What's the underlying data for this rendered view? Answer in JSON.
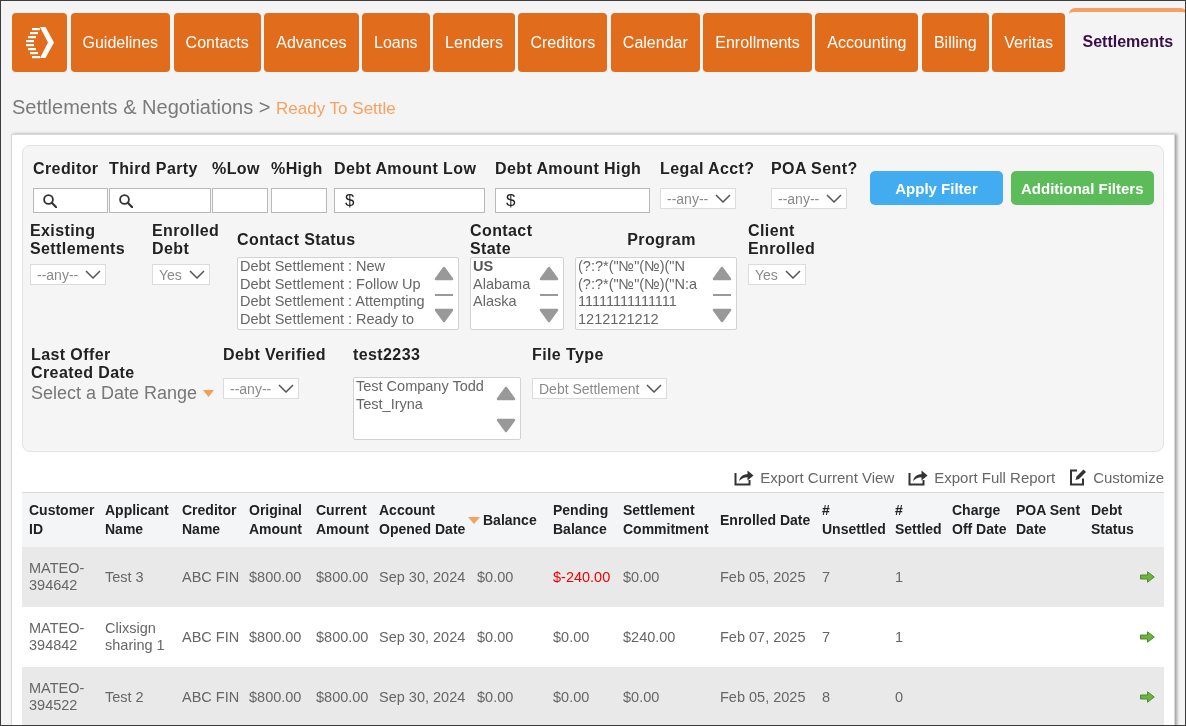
{
  "nav": {
    "tabs": [
      {
        "label": "Guidelines",
        "selected": false
      },
      {
        "label": "Contacts",
        "selected": false
      },
      {
        "label": "Advances",
        "selected": false
      },
      {
        "label": "Loans",
        "selected": false
      },
      {
        "label": "Lenders",
        "selected": false
      },
      {
        "label": "Creditors",
        "selected": false
      },
      {
        "label": "Calendar",
        "selected": false
      },
      {
        "label": "Enrollments",
        "selected": false
      },
      {
        "label": "Accounting",
        "selected": false
      },
      {
        "label": "Billing",
        "selected": false
      },
      {
        "label": "Veritas",
        "selected": false
      },
      {
        "label": "Settlements",
        "selected": true
      }
    ]
  },
  "breadcrumb": {
    "items": [
      {
        "label": "Settlements & Negotiations",
        "current": false
      },
      {
        "label": "Ready To Settle",
        "current": true
      }
    ],
    "separator": ">"
  },
  "filters": {
    "rows": [
      {
        "fields": [
          {
            "kind": "search",
            "label": "Creditor"
          },
          {
            "kind": "search",
            "label": "Third Party"
          },
          {
            "kind": "text",
            "label": "%Low"
          },
          {
            "kind": "text",
            "label": "%High"
          },
          {
            "kind": "money",
            "label": "Debt Amount Low",
            "prefix": "$"
          },
          {
            "kind": "money",
            "label": "Debt Amount High",
            "prefix": "$"
          },
          {
            "kind": "select",
            "label": "Legal Acct?",
            "value": "--any--"
          },
          {
            "kind": "select",
            "label": "POA Sent?",
            "value": "--any--"
          }
        ]
      },
      {
        "fields": [
          {
            "kind": "select",
            "label": "Existing Settlements",
            "value": "--any--"
          },
          {
            "kind": "select",
            "label": "Enrolled Debt",
            "value": "Yes"
          },
          {
            "kind": "listbox",
            "label": "Contact Status",
            "options": [
              {
                "label": "Debt Settlement : New",
                "kind": "option"
              },
              {
                "label": "Debt Settlement : Follow Up",
                "kind": "option"
              },
              {
                "label": "Debt Settlement : Attempting",
                "kind": "option"
              },
              {
                "label": "Debt Settlement : Ready to",
                "kind": "option"
              }
            ]
          },
          {
            "kind": "listbox",
            "label": "Contact State",
            "options": [
              {
                "label": "US",
                "kind": "group"
              },
              {
                "label": "Alabama",
                "kind": "option"
              },
              {
                "label": "Alaska",
                "kind": "option"
              }
            ]
          },
          {
            "kind": "listbox",
            "label": "Program",
            "options": [
              {
                "label": "(?:?*(\"№\"(№)(\"N",
                "kind": "option"
              },
              {
                "label": "(?:?*(\"№\"(№)(\"N:a",
                "kind": "option"
              },
              {
                "label": "11111111111111",
                "kind": "option"
              },
              {
                "label": "1212121212",
                "kind": "option"
              }
            ]
          },
          {
            "kind": "select",
            "label": "Client Enrolled",
            "value": "Yes"
          }
        ]
      },
      {
        "fields": [
          {
            "kind": "daterange",
            "label": "Last Offer Created Date",
            "placeholder": "Select a Date Range"
          },
          {
            "kind": "select",
            "label": "Debt Verified",
            "value": "--any--"
          },
          {
            "kind": "listbox",
            "label": "test2233",
            "options": [
              {
                "label": "Test Company Todd",
                "kind": "option"
              },
              {
                "label": "Test_Iryna",
                "kind": "option"
              }
            ]
          },
          {
            "kind": "select",
            "label": "File Type",
            "value": "Debt Settlement"
          }
        ]
      }
    ],
    "buttons": [
      {
        "label": "Apply Filter",
        "kind": "primary"
      },
      {
        "label": "Additional Filters",
        "kind": "success"
      }
    ]
  },
  "export_bar": [
    {
      "label": "Export Current View",
      "kind": "export"
    },
    {
      "label": "Export Full Report",
      "kind": "export"
    },
    {
      "label": "Customize",
      "kind": "customize"
    }
  ],
  "table": {
    "columns": [
      {
        "label": "Customer ID",
        "sorted": false
      },
      {
        "label": "Applicant Name",
        "sorted": false
      },
      {
        "label": "Creditor Name",
        "sorted": false
      },
      {
        "label": "Original Amount",
        "sorted": false
      },
      {
        "label": "Current Amount",
        "sorted": false
      },
      {
        "label": "Account Opened Date",
        "sorted": false
      },
      {
        "label": "Balance",
        "sorted": true
      },
      {
        "label": "Pending Balance",
        "sorted": false
      },
      {
        "label": "Settlement Commitment",
        "sorted": false
      },
      {
        "label": "Enrolled Date",
        "sorted": false
      },
      {
        "label": "# Unsettled",
        "sorted": false
      },
      {
        "label": "# Settled",
        "sorted": false
      },
      {
        "label": "Charge Off Date",
        "sorted": false
      },
      {
        "label": "POA Sent Date",
        "sorted": false
      },
      {
        "label": "Debt Status",
        "sorted": false
      }
    ],
    "rows": [
      {
        "cells": [
          {
            "text": "MATEO-394642",
            "kind": "plain"
          },
          {
            "text": "Test 3",
            "kind": "plain"
          },
          {
            "text": "ABC FIN",
            "kind": "plain"
          },
          {
            "text": "$800.00",
            "kind": "plain"
          },
          {
            "text": "$800.00",
            "kind": "plain"
          },
          {
            "text": "Sep 30, 2024",
            "kind": "plain"
          },
          {
            "text": "$0.00",
            "kind": "plain"
          },
          {
            "text": "$-240.00",
            "kind": "negative"
          },
          {
            "text": "$0.00",
            "kind": "plain"
          },
          {
            "text": "Feb 05, 2025",
            "kind": "plain"
          },
          {
            "text": "7",
            "kind": "plain"
          },
          {
            "text": "1",
            "kind": "plain"
          }
        ]
      },
      {
        "cells": [
          {
            "text": "MATEO-394842",
            "kind": "plain"
          },
          {
            "text": "Clixsign sharing 1",
            "kind": "plain"
          },
          {
            "text": "ABC FIN",
            "kind": "plain"
          },
          {
            "text": "$800.00",
            "kind": "plain"
          },
          {
            "text": "$800.00",
            "kind": "plain"
          },
          {
            "text": "Sep 30, 2024",
            "kind": "plain"
          },
          {
            "text": "$0.00",
            "kind": "plain"
          },
          {
            "text": "$0.00",
            "kind": "plain"
          },
          {
            "text": "$240.00",
            "kind": "plain"
          },
          {
            "text": "Feb 07, 2025",
            "kind": "plain"
          },
          {
            "text": "7",
            "kind": "plain"
          },
          {
            "text": "1",
            "kind": "plain"
          }
        ]
      },
      {
        "cells": [
          {
            "text": "MATEO-394522",
            "kind": "plain"
          },
          {
            "text": "Test 2",
            "kind": "plain"
          },
          {
            "text": "ABC FIN",
            "kind": "plain"
          },
          {
            "text": "$800.00",
            "kind": "plain"
          },
          {
            "text": "$800.00",
            "kind": "plain"
          },
          {
            "text": "Sep 30, 2024",
            "kind": "plain"
          },
          {
            "text": "$0.00",
            "kind": "plain"
          },
          {
            "text": "$0.00",
            "kind": "plain"
          },
          {
            "text": "$0.00",
            "kind": "plain"
          },
          {
            "text": "Feb 05, 2025",
            "kind": "plain"
          },
          {
            "text": "8",
            "kind": "plain"
          },
          {
            "text": "0",
            "kind": "plain"
          }
        ]
      }
    ]
  }
}
